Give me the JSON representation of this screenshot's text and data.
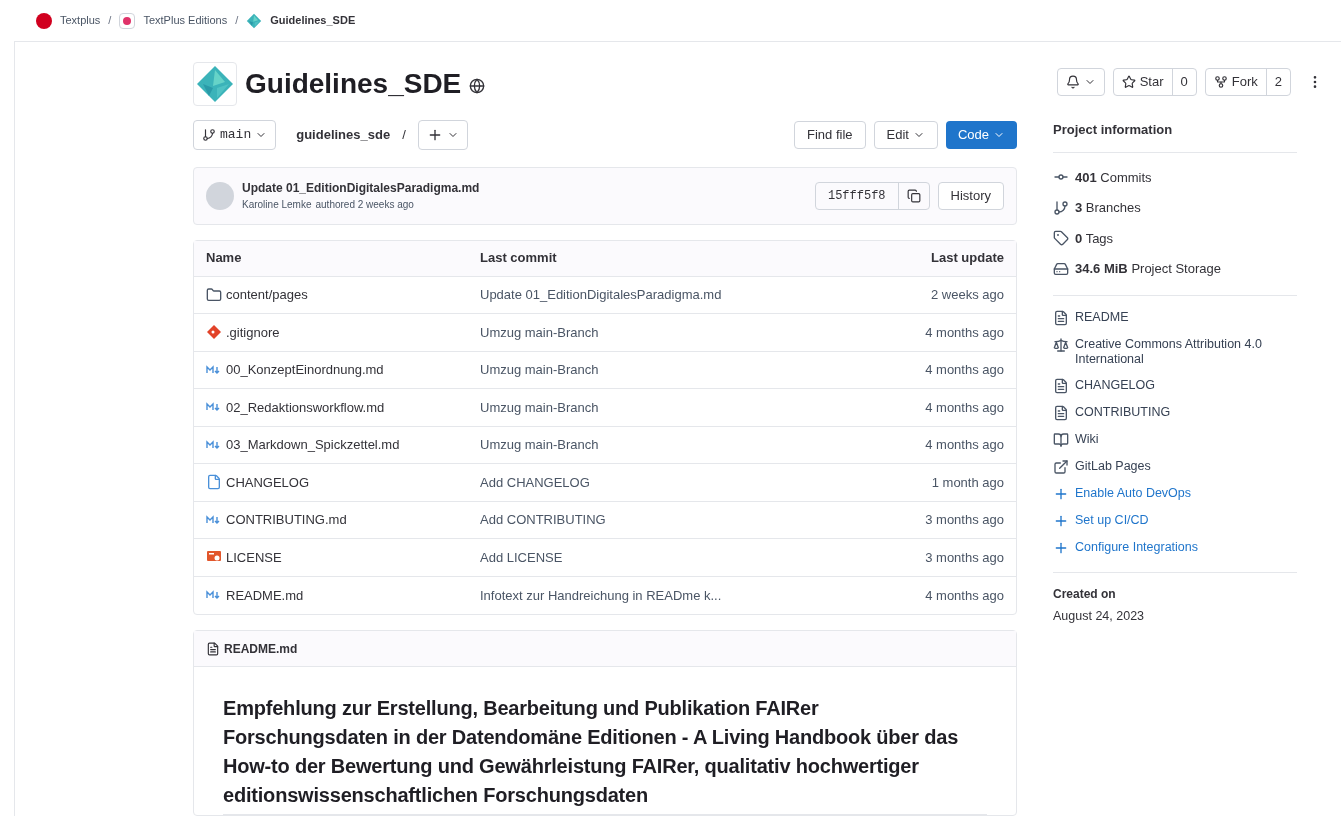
{
  "breadcrumbs": [
    {
      "label": "Textplus",
      "kind": "group",
      "current": false
    },
    {
      "label": "TextPlus Editions",
      "kind": "subgroup",
      "current": false
    },
    {
      "label": "Guidelines_SDE",
      "kind": "project",
      "current": true
    }
  ],
  "breadcrumb_separator": "/",
  "project": {
    "title": "Guidelines_SDE",
    "public": true
  },
  "actions": {
    "star": {
      "label": "Star",
      "count": "0"
    },
    "fork": {
      "label": "Fork",
      "count": "2"
    }
  },
  "branch": "main",
  "path": "guidelines_sde",
  "path_separator": "/",
  "repo_buttons": {
    "find_file": "Find file",
    "edit": "Edit",
    "code": "Code"
  },
  "last_commit": {
    "message": "Update 01_EditionDigitalesParadigma.md",
    "author": "Karoline Lemke",
    "meta": "authored 2 weeks ago",
    "sha": "15fff5f8",
    "history": "History"
  },
  "table": {
    "columns": [
      "Name",
      "Last commit",
      "Last update"
    ],
    "rows": [
      {
        "kind": "folder",
        "name": "content/pages",
        "commit": "Update 01_EditionDigitalesParadigma.md",
        "updated": "2 weeks ago"
      },
      {
        "kind": "git",
        "name": ".gitignore",
        "commit": "Umzug main-Branch",
        "updated": "4 months ago"
      },
      {
        "kind": "markdown",
        "name": "00_KonzeptEinordnung.md",
        "commit": "Umzug main-Branch",
        "updated": "4 months ago"
      },
      {
        "kind": "markdown",
        "name": "02_Redaktionsworkflow.md",
        "commit": "Umzug main-Branch",
        "updated": "4 months ago"
      },
      {
        "kind": "markdown",
        "name": "03_Markdown_Spickzettel.md",
        "commit": "Umzug main-Branch",
        "updated": "4 months ago"
      },
      {
        "kind": "file",
        "name": "CHANGELOG",
        "commit": "Add CHANGELOG",
        "updated": "1 month ago"
      },
      {
        "kind": "markdown",
        "name": "CONTRIBUTING.md",
        "commit": "Add CONTRIBUTING",
        "updated": "3 months ago"
      },
      {
        "kind": "license",
        "name": "LICENSE",
        "commit": "Add LICENSE",
        "updated": "3 months ago"
      },
      {
        "kind": "markdown",
        "name": "README.md",
        "commit": "Infotext zur Handreichung in READme k...",
        "updated": "4 months ago"
      }
    ]
  },
  "readme": {
    "filename": "README.md",
    "heading": "Empfehlung zur Erstellung, Bearbeitung und Publikation FAIRer Forschungsdaten in der Datendomäne Editionen - A Living Handbook über das How-to der Bewertung und Gewährleistung FAIRer, qualitativ hochwertiger editionswissenschaftlichen Forschungsdaten"
  },
  "sidebar": {
    "title": "Project information",
    "stats": [
      {
        "kind": "commit",
        "value": "401",
        "label": "Commits"
      },
      {
        "kind": "branch",
        "value": "3",
        "label": "Branches"
      },
      {
        "kind": "tag",
        "value": "0",
        "label": "Tags"
      },
      {
        "kind": "storage",
        "value": "34.6 MiB",
        "label": "Project Storage"
      }
    ],
    "links": [
      {
        "kind": "doc",
        "label": "README"
      },
      {
        "kind": "license",
        "label": "Creative Commons Attribution 4.0 International"
      },
      {
        "kind": "doc",
        "label": "CHANGELOG"
      },
      {
        "kind": "doc",
        "label": "CONTRIBUTING"
      },
      {
        "kind": "book",
        "label": "Wiki"
      },
      {
        "kind": "external",
        "label": "GitLab Pages"
      },
      {
        "kind": "add",
        "label": "Enable Auto DevOps"
      },
      {
        "kind": "add",
        "label": "Set up CI/CD"
      },
      {
        "kind": "add",
        "label": "Configure Integrations"
      }
    ],
    "created_label": "Created on",
    "created_date": "August 24, 2023"
  }
}
